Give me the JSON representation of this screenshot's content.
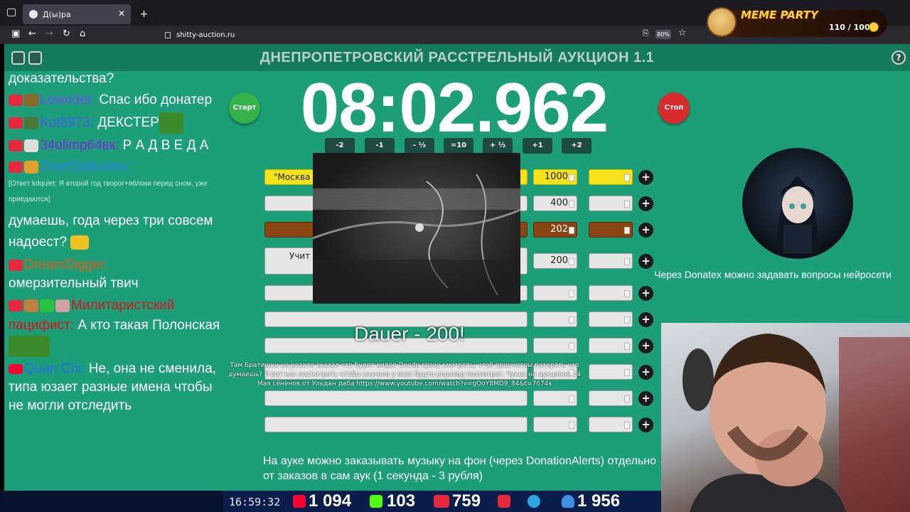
{
  "browser": {
    "tab_title": "Д(ы)ра",
    "url": "shitty-auction.ru",
    "zoom": "80%"
  },
  "meme_party": {
    "title": "MEME PARTY",
    "count": "110 / 1000"
  },
  "site": {
    "title": "ДНЕПРОПЕТРОВСКИЙ РАССТРЕЛЬНЫЙ АУКЦИОН 1.1",
    "help": "?"
  },
  "chat": [
    {
      "text": "доказательства?"
    },
    {
      "nick": "Lowrider:",
      "nick_color": "#6a50f0",
      "text": " Спас ибо донатер"
    },
    {
      "nick": "Kot8973:",
      "nick_color": "#4a5cf0",
      "text": " ДЕКСТЕР"
    },
    {
      "nick": "34olimp64вк:",
      "nick_color": "#7a2ce0",
      "text": " Р А Д В Е Д А"
    },
    {
      "nick": "ZvonStakanov:",
      "nick_color": "#2c7cf0",
      "text": ""
    },
    {
      "reply": "[Ответ kdquiet: Я второй год творог+яблоки перед сном, уже приедаются]"
    },
    {
      "text": "думаешь, года через три совсем надоест?"
    },
    {
      "nick": "DreamDigger:",
      "nick_color": "#e05a1a",
      "text": ""
    },
    {
      "text": "омерзительный твич"
    },
    {
      "nick": "Милитаристский пацифист:",
      "nick_color": "#e0101a",
      "text": " А кто такая Полонская"
    },
    {
      "nick": "Quan Chi:",
      "nick_color": "#2c6cf0",
      "text": " Не, она не сменила, типа юзает разные имена чтобы не могли отследить"
    }
  ],
  "timer": {
    "value": "08:02.962",
    "start_label": "Старт",
    "stop_label": "Стоп",
    "adjust": [
      "-2",
      "-1",
      "- ½",
      "=10",
      "+ ½",
      "+1",
      "+2"
    ]
  },
  "lots": [
    {
      "name": "\"Москва",
      "amount": "1000",
      "extra": ""
    },
    {
      "name": "",
      "amount": "400",
      "extra": ""
    },
    {
      "name": "",
      "amount": "202",
      "extra": ""
    },
    {
      "name": "Учит",
      "amount": "200",
      "extra": ""
    },
    {
      "name": "",
      "amount": "",
      "extra": ""
    },
    {
      "name": "",
      "amount": "",
      "extra": ""
    },
    {
      "name": "",
      "amount": "",
      "extra": ""
    },
    {
      "name": "",
      "amount": "",
      "extra": ""
    },
    {
      "name": "",
      "amount": "",
      "extra": ""
    },
    {
      "name": "",
      "amount": "",
      "extra": ""
    }
  ],
  "colors": {
    "page_bg": "#1c9e78",
    "header_bg": "#137a5d",
    "lot_yellow": "#f5e11c",
    "lot_brown": "#8b4513",
    "start": "#36b24a",
    "stop": "#d82c2c"
  },
  "overlay": {
    "dauer": "Dauer - 200!",
    "ticker": "Там Братишки на реакте сказал что будет видео Deadp сразу смотреть, чтоб просмотры потерять что думаешь? И вот как посмотреть чтобы сначала у всех будто вприход посмотрят. Чуков на аукционе 14 Мая сёненов от Ульдан даба https://www.youtube.com/watch?v=gOoY8MD9_84&t=7674s"
  },
  "notice": "На ауке можно заказывать музыку на фон (через DonationAlerts) отдельно от заказов в сам аук (1 секунда - 3 рубля)",
  "donatex": "Через Donatex можно задавать вопросы нейросети",
  "status": {
    "clock": "16:59:32",
    "youtube": "1 094",
    "kick": "103",
    "live": "759",
    "viewers": "1 956"
  }
}
